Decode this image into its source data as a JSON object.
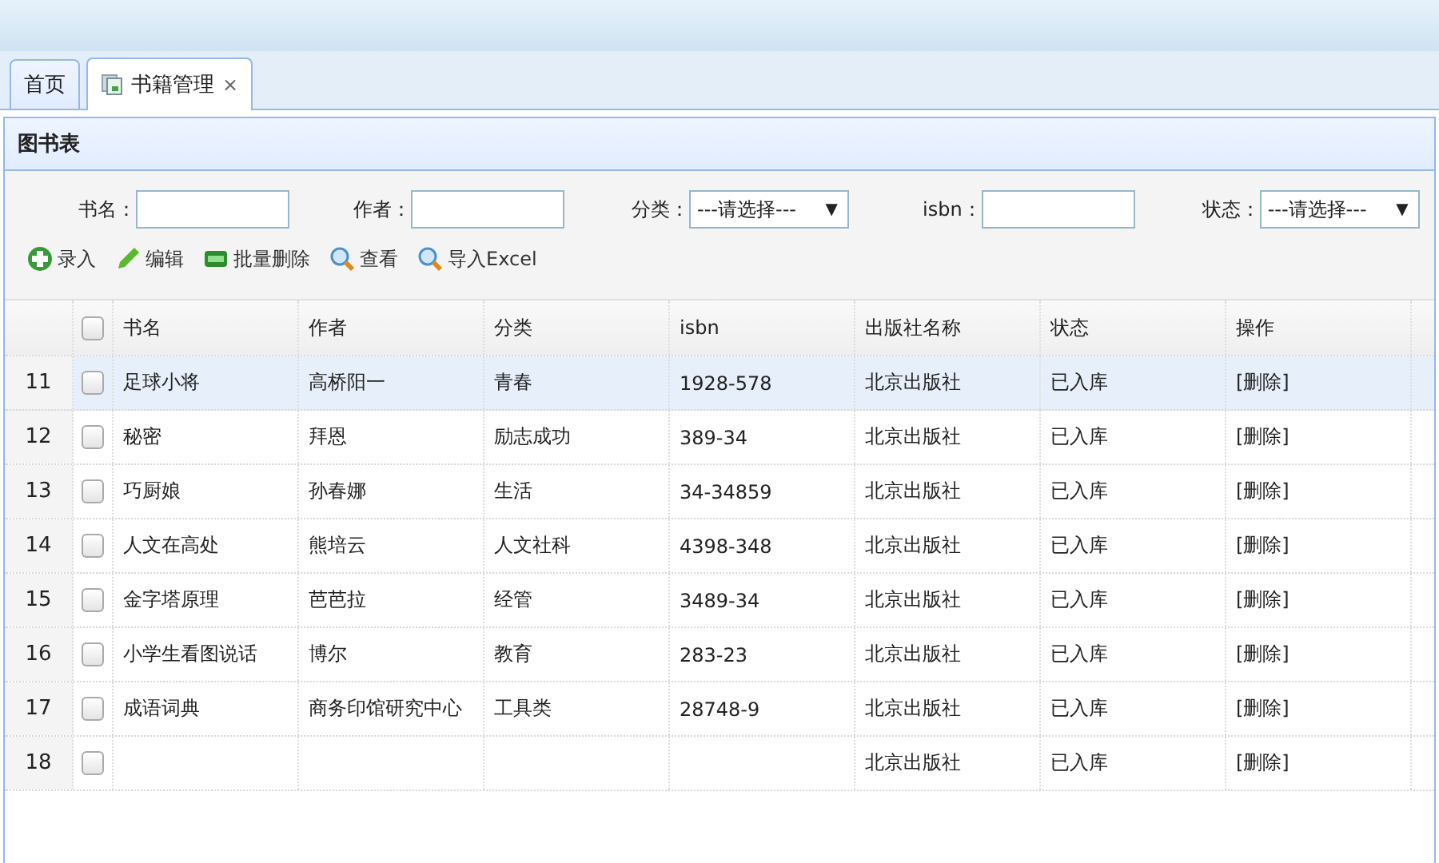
{
  "tabs": [
    {
      "label": "首页",
      "selected": false,
      "closable": false
    },
    {
      "label": "书籍管理",
      "selected": true,
      "closable": true,
      "close": "×"
    }
  ],
  "panel": {
    "title": "图书表"
  },
  "filters": [
    {
      "kind": "text",
      "label": "书名："
    },
    {
      "kind": "text",
      "label": "作者："
    },
    {
      "kind": "select",
      "label": "分类：",
      "value": "---请选择---",
      "caret": "▼"
    },
    {
      "kind": "text",
      "label": "isbn："
    },
    {
      "kind": "select",
      "label": "状态：",
      "value": "---请选择---",
      "caret": "▼"
    }
  ],
  "toolbar": [
    {
      "kind": "add",
      "label": "录入"
    },
    {
      "kind": "edit",
      "label": "编辑"
    },
    {
      "kind": "delete",
      "label": "批量删除"
    },
    {
      "kind": "search",
      "label": "查看"
    },
    {
      "kind": "search",
      "label": "导入Excel"
    }
  ],
  "table": {
    "columns": [
      "书名",
      "作者",
      "分类",
      "isbn",
      "出版社名称",
      "状态",
      "操作"
    ],
    "header_checked": false,
    "rows": [
      {
        "num": "11",
        "selected": true,
        "checked": false,
        "cells": [
          "足球小将",
          "高桥阳一",
          "青春",
          "1928-578",
          "北京出版社",
          "已入库",
          "[删除]"
        ]
      },
      {
        "num": "12",
        "selected": false,
        "checked": false,
        "cells": [
          "秘密",
          "拜恩",
          "励志成功",
          "389-34",
          "北京出版社",
          "已入库",
          "[删除]"
        ]
      },
      {
        "num": "13",
        "selected": false,
        "checked": false,
        "cells": [
          "巧厨娘",
          "孙春娜",
          "生活",
          "34-34859",
          "北京出版社",
          "已入库",
          "[删除]"
        ]
      },
      {
        "num": "14",
        "selected": false,
        "checked": false,
        "cells": [
          "人文在高处",
          "熊培云",
          "人文社科",
          "4398-348",
          "北京出版社",
          "已入库",
          "[删除]"
        ]
      },
      {
        "num": "15",
        "selected": false,
        "checked": false,
        "cells": [
          "金字塔原理",
          "芭芭拉",
          "经管",
          "3489-34",
          "北京出版社",
          "已入库",
          "[删除]"
        ]
      },
      {
        "num": "16",
        "selected": false,
        "checked": false,
        "cells": [
          "小学生看图说话",
          "博尔",
          "教育",
          "283-23",
          "北京出版社",
          "已入库",
          "[删除]"
        ]
      },
      {
        "num": "17",
        "selected": false,
        "checked": false,
        "cells": [
          "成语词典",
          "商务印馆研究中心",
          "工具类",
          "28748-9",
          "北京出版社",
          "已入库",
          "[删除]"
        ]
      },
      {
        "num": "18",
        "selected": false,
        "checked": false,
        "cells": [
          "",
          "",
          "",
          "",
          "北京出版社",
          "已入库",
          "[删除]"
        ]
      }
    ]
  }
}
